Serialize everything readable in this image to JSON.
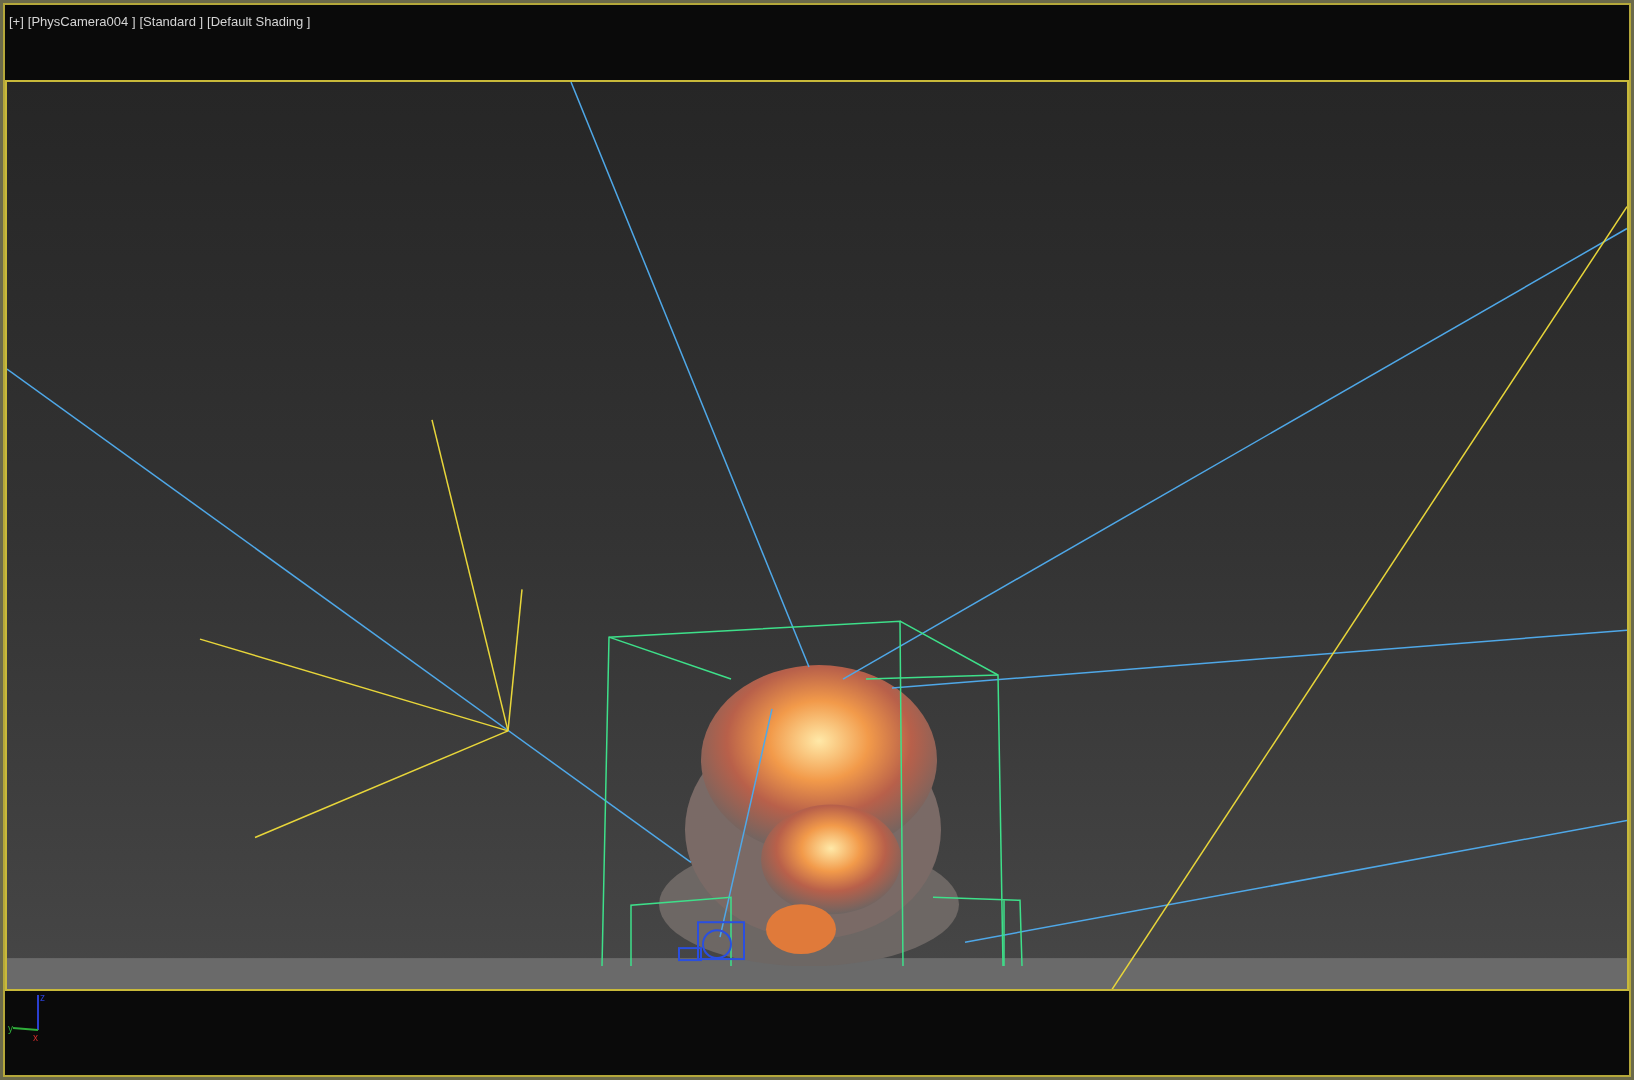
{
  "viewport": {
    "labels": [
      "[+]",
      "[PhysCamera004 ]",
      "[Standard ]",
      "[Default Shading ]"
    ]
  },
  "axis_tripod": {
    "labels": [
      "z",
      "y",
      "x"
    ]
  }
}
